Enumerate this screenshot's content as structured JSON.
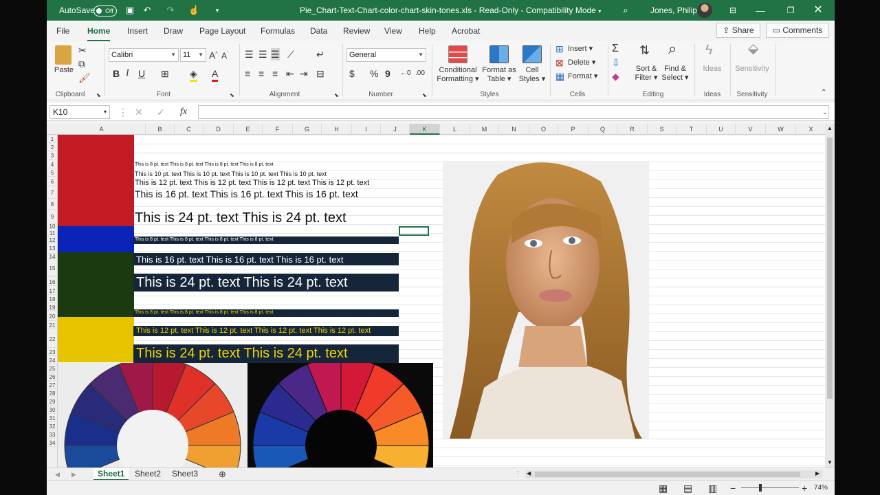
{
  "titlebar": {
    "autosave_label": "AutoSave",
    "autosave_state": "Off",
    "filename": "Pie_Chart-Text-Chart-color-chart-skin-tones.xls",
    "separator": "-",
    "readonly": "Read-Only",
    "separator2": "-",
    "mode": "Compatibility Mode",
    "user": "Jones, Philip"
  },
  "tabs": [
    "File",
    "Home",
    "Insert",
    "Draw",
    "Page Layout",
    "Formulas",
    "Data",
    "Review",
    "View",
    "Help",
    "Acrobat"
  ],
  "share_label": "Share",
  "comments_label": "Comments",
  "ribbon": {
    "clipboard": {
      "paste": "Paste",
      "label": "Clipboard"
    },
    "font": {
      "name": "Calibri",
      "size": "11",
      "label": "Font"
    },
    "alignment": {
      "label": "Alignment"
    },
    "number": {
      "format": "General",
      "currency": "$",
      "percent": "%",
      "comma": "9",
      "label": "Number"
    },
    "styles": {
      "conditional": "Conditional",
      "conditional2": "Formatting",
      "format_as": "Format as",
      "format_as2": "Table",
      "cell": "Cell",
      "cell2": "Styles",
      "label": "Styles"
    },
    "cells": {
      "insert": "Insert",
      "delete": "Delete",
      "format": "Format",
      "label": "Cells"
    },
    "editing": {
      "sort": "Sort &",
      "sort2": "Filter",
      "find": "Find &",
      "find2": "Select",
      "label": "Editing"
    },
    "ideas": {
      "ideas": "Ideas",
      "label": "Ideas"
    },
    "sensitivity": {
      "sensitivity": "Sensitivity",
      "label": "Sensitivity"
    }
  },
  "formula_bar": {
    "namebox": "K10",
    "fx": "fx",
    "content": ""
  },
  "columns": [
    "A",
    "B",
    "C",
    "D",
    "E",
    "F",
    "G",
    "H",
    "I",
    "J",
    "K",
    "L",
    "M",
    "N",
    "O",
    "P",
    "Q",
    "R",
    "S",
    "T",
    "U",
    "V",
    "W",
    "X"
  ],
  "rows": [
    "1",
    "2",
    "3",
    "4",
    "5",
    "6",
    "7",
    "8",
    "9",
    "10",
    "11",
    "12",
    "13",
    "14",
    "15",
    "16",
    "17",
    "18",
    "19",
    "20",
    "21",
    "22",
    "23",
    "24",
    "25",
    "26",
    "27",
    "28",
    "29",
    "30",
    "31",
    "32",
    "33",
    "34"
  ],
  "cell_text": {
    "r4": "This is 8 pt. text   This is 8 pt. text   This is 8 pt. text   This is 8 pt. text",
    "r5": "This is 10 pt. text   This is 10 pt. text   This is 10 pt. text   This is 10 pt. text",
    "r6": "This is 12 pt. text   This is 12 pt. text   This is 12 pt. text   This is 12 pt. text",
    "r7": "This is 16 pt. text   This is 16 pt. text   This is 16 pt. text",
    "r9": "This is 24 pt. text   This is 24 pt. text",
    "r11": "This is 8 pt. text   This is 8 pt. text   This is 8 pt. text   This is 8 pt. text",
    "r13": "This is 16 pt. text   This is 16 pt. text   This is 16 pt. text",
    "r15": "This is 24 pt. text   This is 24 pt. text",
    "r18": "This is 8 pt. text   This is 8 pt. text   This is 8 pt. text   This is 8 pt. text",
    "r20": "This is 12 pt. text   This is 12 pt. text   This is 12 pt. text   This is 12 pt. text",
    "r22": "This is 24 pt. text   This is 24 pt. text"
  },
  "colors": {
    "red": "#c41a24",
    "blue": "#0a24b8",
    "green": "#1c3a10",
    "yellow": "#e8c400",
    "band": "#15263a",
    "excel_green": "#217346"
  },
  "sheets": [
    "Sheet1",
    "Sheet2",
    "Sheet3"
  ],
  "status": {
    "zoom": "74%"
  }
}
